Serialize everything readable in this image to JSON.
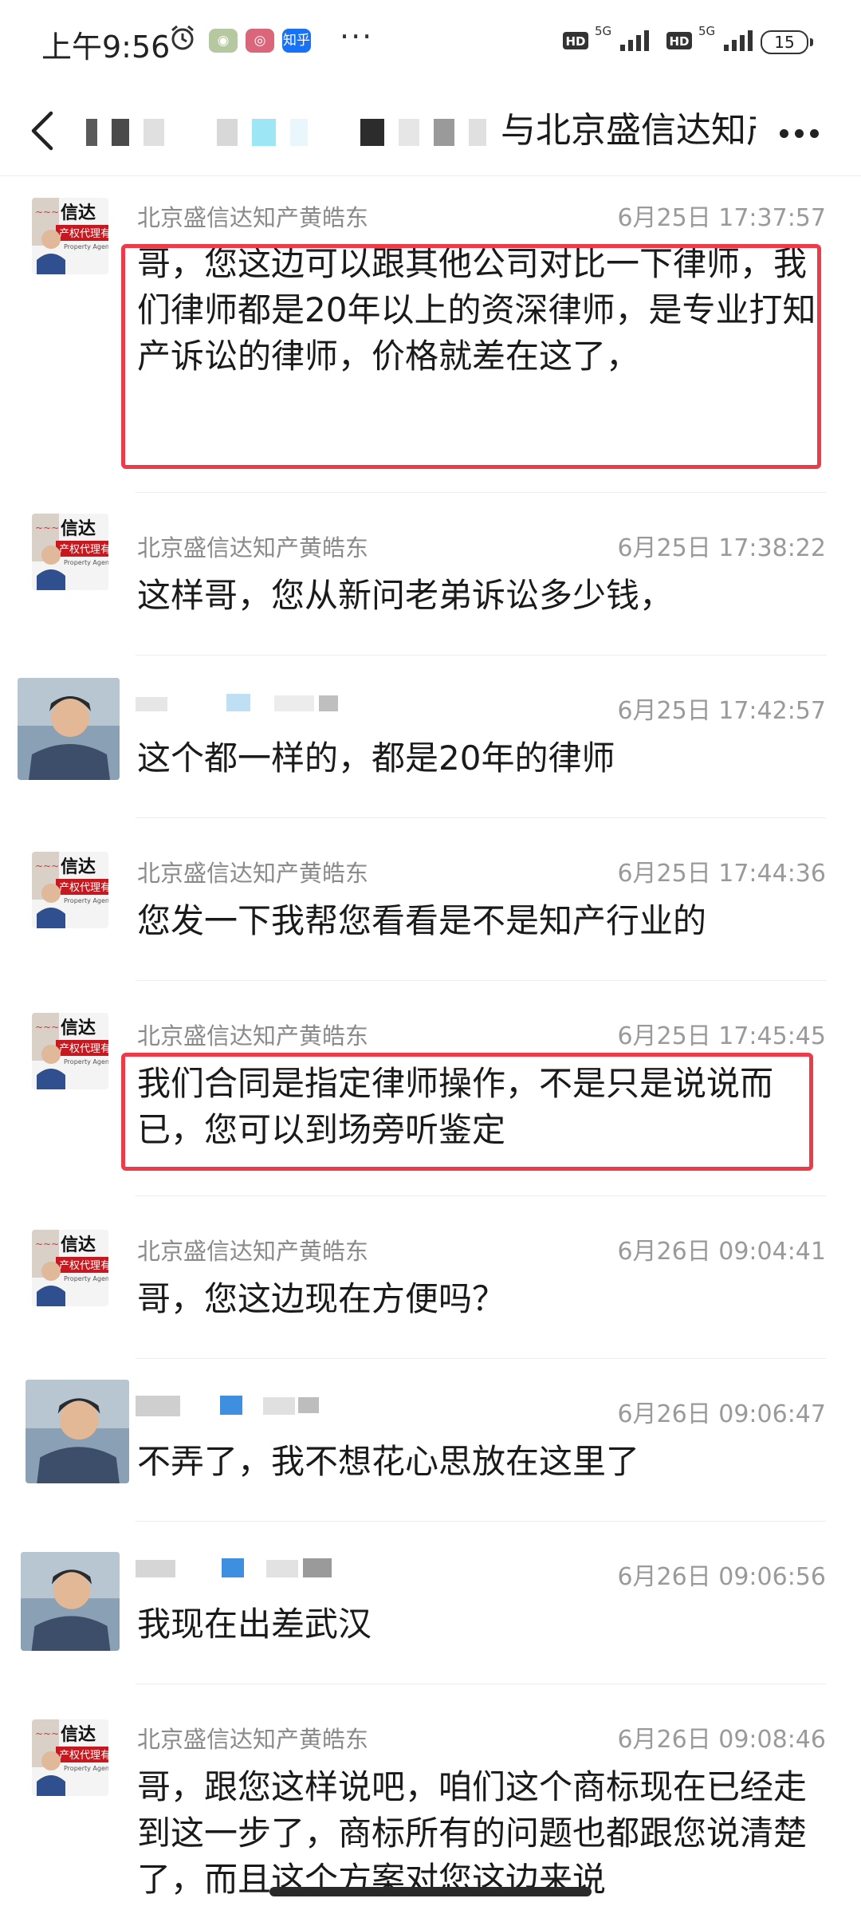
{
  "status_bar": {
    "time": "上午9:56",
    "app_label_zhihu": "知乎",
    "more": "···",
    "net1": "HD",
    "net1_type": "5G",
    "net2": "HD",
    "net2_type": "5G",
    "battery": "15"
  },
  "header": {
    "title": "与北京盛信达知产黄…"
  },
  "messages": [
    {
      "sender": "北京盛信达知产黄皓东",
      "time": "6月25日 17:37:57",
      "text": "哥，您这边可以跟其他公司对比一下律师，我们律师都是20年以上的资深律师，是专业打知产诉讼的律师，价格就差在这了，",
      "highlighted": true
    },
    {
      "sender": "北京盛信达知产黄皓东",
      "time": "6月25日 17:38:22",
      "text": "这样哥，您从新问老弟诉讼多少钱，",
      "highlighted": false
    },
    {
      "sender": "",
      "time": "6月25日 17:42:57",
      "text": "这个都一样的，都是20年的律师",
      "highlighted": false
    },
    {
      "sender": "北京盛信达知产黄皓东",
      "time": "6月25日 17:44:36",
      "text": "您发一下我帮您看看是不是知产行业的",
      "highlighted": false
    },
    {
      "sender": "北京盛信达知产黄皓东",
      "time": "6月25日 17:45:45",
      "text": "我们合同是指定律师操作，不是只是说说而已，您可以到场旁听鉴定",
      "highlighted": true
    },
    {
      "sender": "北京盛信达知产黄皓东",
      "time": "6月26日 09:04:41",
      "text": "哥，您这边现在方便吗？",
      "highlighted": false
    },
    {
      "sender": "",
      "time": "6月26日 09:06:47",
      "text": "不弄了，我不想花心思放在这里了",
      "highlighted": false
    },
    {
      "sender": "",
      "time": "6月26日 09:06:56",
      "text": "我现在出差武汉",
      "highlighted": false
    },
    {
      "sender": "北京盛信达知产黄皓东",
      "time": "6月26日 09:08:46",
      "text": "哥，跟您这样说吧，咱们这个商标现在已经走到这一步了，商标所有的问题也都跟您说清楚了，而且这个方案对您这边来说",
      "highlighted": false
    }
  ],
  "avatar_texts": {
    "company_main": "信达",
    "company_sub": "产权代理有",
    "company_en": "Property Agen"
  },
  "colors": {
    "highlight": "#ee3b4a",
    "meta_gray": "#9a9a9a",
    "text": "#1a1a1a"
  }
}
